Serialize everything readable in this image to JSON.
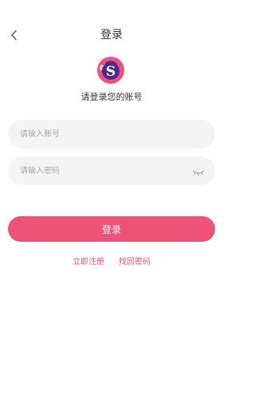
{
  "header": {
    "back_icon": "chevron-left-icon",
    "title": "登录"
  },
  "logo_icon": "app-logo",
  "subtitle": "请登录您的账号",
  "form": {
    "account_placeholder": "请输入账号",
    "account_value": "",
    "password_placeholder": "请输入密码",
    "password_value": "",
    "password_toggle_icon": "eye-closed-icon",
    "login_label": "登录"
  },
  "links": {
    "register": "立即注册",
    "recover_password": "找回密码"
  },
  "colors": {
    "accent": "#ee5277",
    "field_background": "#f4f4f5",
    "placeholder": "#aaaaaa"
  }
}
